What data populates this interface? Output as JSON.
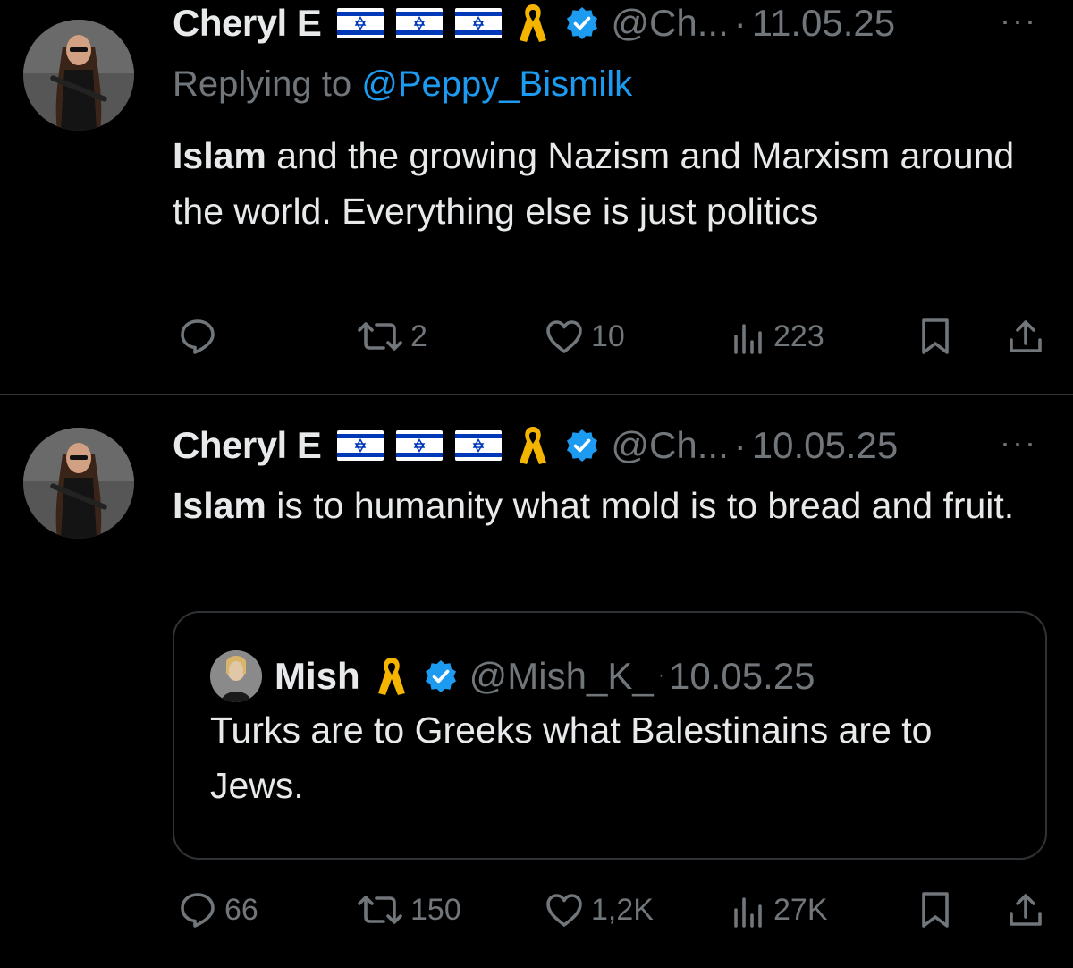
{
  "tweets": [
    {
      "author_name": "Cheryl E",
      "handle": "@Ch...",
      "separator": "·",
      "date": "11.05.25",
      "more": "···",
      "replying_to_prefix": "Replying to",
      "replying_to_handle": "@Peppy_Bismilk",
      "text_bold": "Islam",
      "text_rest": " and the growing Nazism and Marxism around the world. Everything else is just politics",
      "reply_count": "",
      "repost_count": "2",
      "like_count": "10",
      "view_count": "223"
    },
    {
      "author_name": "Cheryl E",
      "handle": "@Ch...",
      "separator": "·",
      "date": "10.05.25",
      "more": "···",
      "text_bold": "Islam",
      "text_rest": " is to humanity what mold is to bread and fruit.",
      "reply_count": "66",
      "repost_count": "150",
      "like_count": "1,2K",
      "view_count": "27K",
      "quoted": {
        "author_name": "Mish",
        "handle": "@Mish_K_",
        "separator": "·",
        "date": "10.05.25",
        "text": "Turks are to Greeks what Balestinains are to Jews."
      }
    }
  ],
  "icons": {
    "flag": "israel-flag-icon",
    "ribbon": "yellow-ribbon-icon",
    "verified": "verified-badge-icon",
    "reply": "reply-icon",
    "repost": "repost-icon",
    "like": "heart-icon",
    "views": "views-icon",
    "bookmark": "bookmark-icon",
    "share": "share-icon"
  },
  "colors": {
    "background": "#000000",
    "text": "#e7e9ea",
    "muted": "#71767b",
    "link": "#1d9bf0",
    "divider": "#2f3336",
    "ribbon": "#f4b400",
    "verified": "#1d9bf0"
  }
}
